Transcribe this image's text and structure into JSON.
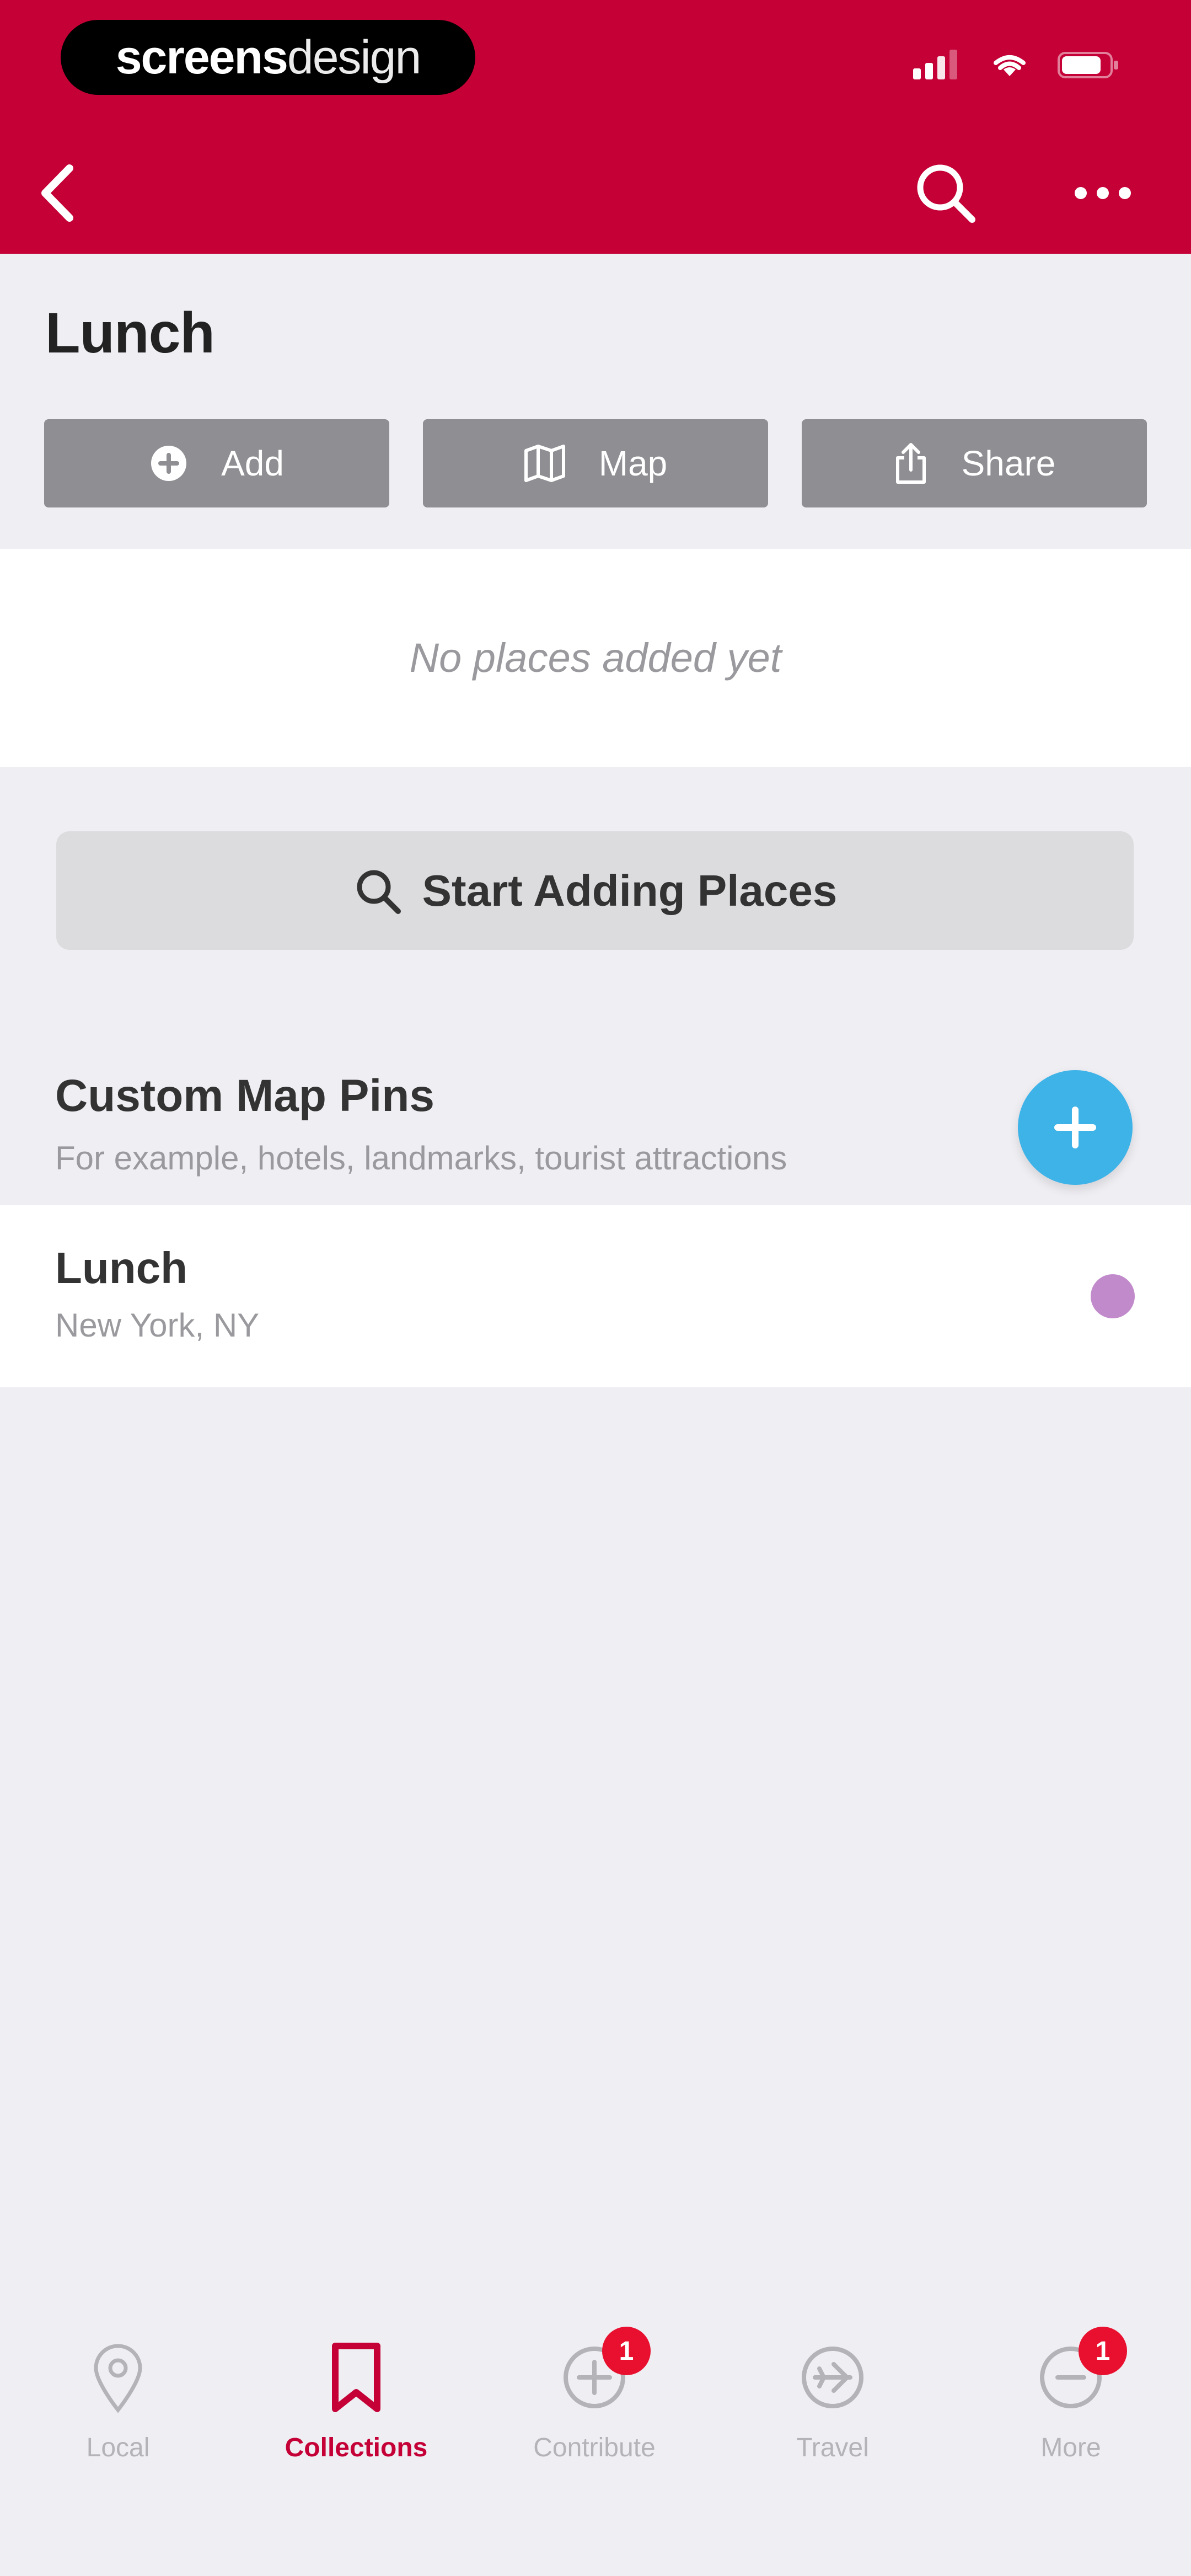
{
  "brand": {
    "part1": "screens",
    "part2": "design"
  },
  "header": {},
  "page": {
    "title": "Lunch",
    "actions": [
      {
        "label": "Add",
        "icon": "plus-circle-icon"
      },
      {
        "label": "Map",
        "icon": "map-icon"
      },
      {
        "label": "Share",
        "icon": "share-icon"
      }
    ],
    "empty_message": "No places added yet",
    "start_button_label": "Start Adding Places"
  },
  "custom_pins": {
    "title": "Custom Map Pins",
    "subtitle": "For example, hotels, landmarks, tourist attractions",
    "items": [
      {
        "name": "Lunch",
        "location": "New York, NY",
        "pin_color": "#C18BCB"
      }
    ]
  },
  "tabbar": {
    "tabs": [
      {
        "label": "Local",
        "icon": "location-pin-icon",
        "active": false,
        "badge": ""
      },
      {
        "label": "Collections",
        "icon": "bookmark-icon",
        "active": true,
        "badge": ""
      },
      {
        "label": "Contribute",
        "icon": "plus-circle-icon",
        "active": false,
        "badge": "1"
      },
      {
        "label": "Travel",
        "icon": "airplane-circle-icon",
        "active": false,
        "badge": ""
      },
      {
        "label": "More",
        "icon": "more-circle-icon",
        "active": false,
        "badge": "1"
      }
    ]
  },
  "colors": {
    "header_bg": "#C40036",
    "accent": "#C40036",
    "fab": "#3EB3E8",
    "badge": "#E8102E",
    "page_bg": "#EFEEF3",
    "button_gray": "#8E8E93"
  }
}
